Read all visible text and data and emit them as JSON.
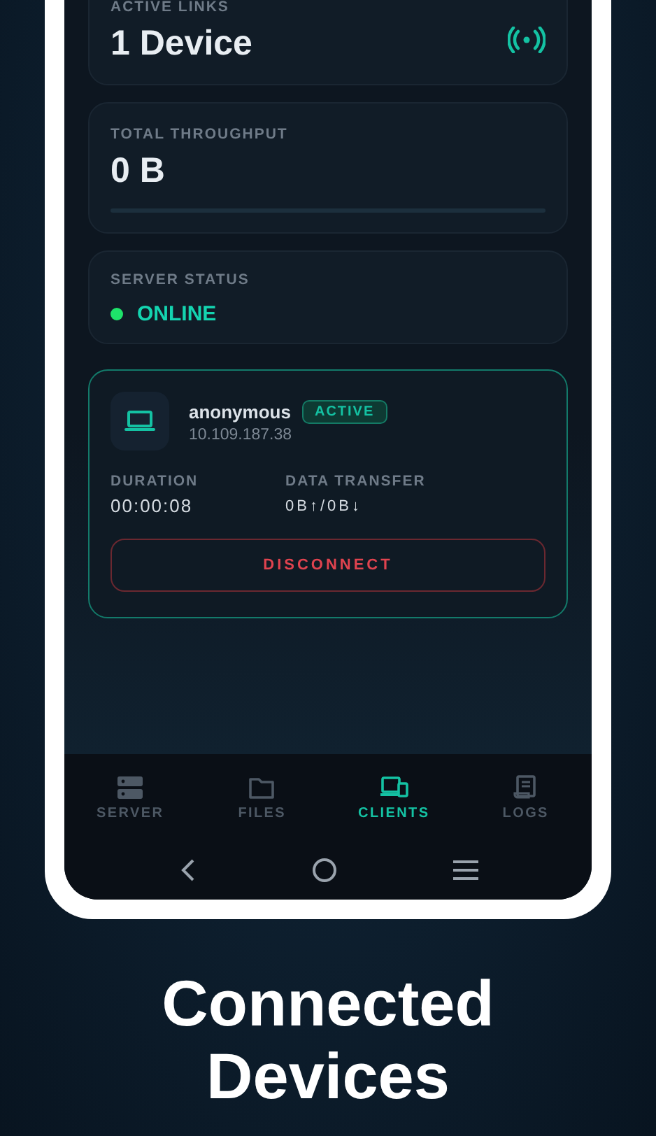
{
  "stats": [
    {
      "kind": "count",
      "label": "ACTIVE LINKS",
      "value": "1 Device"
    },
    {
      "kind": "throughput",
      "label": "TOTAL THROUGHPUT",
      "value": "0 B",
      "level": 0
    },
    {
      "kind": "status",
      "label": "SERVER STATUS",
      "value": "ONLINE",
      "online": true
    }
  ],
  "client": {
    "name": "anonymous",
    "badge": "ACTIVE",
    "active": true,
    "ip": "10.109.187.38",
    "fields": [
      {
        "label": "DURATION",
        "value": "00:00:08"
      },
      {
        "label": "DATA TRANSFER",
        "value": "0B↑/0B↓"
      }
    ],
    "action": "DISCONNECT"
  },
  "nav": [
    {
      "label": "SERVER",
      "selected": false
    },
    {
      "label": "FILES",
      "selected": false
    },
    {
      "label": "CLIENTS",
      "selected": true
    },
    {
      "label": "LOGS",
      "selected": false
    }
  ],
  "caption": "Connected Devices"
}
